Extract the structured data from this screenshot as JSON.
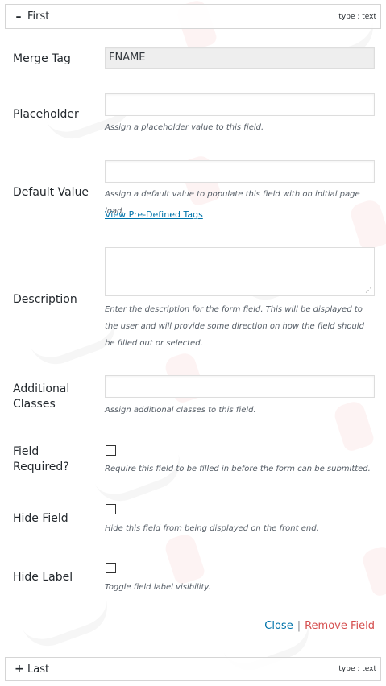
{
  "top_panel": {
    "toggle_symbol": "–",
    "title": "First",
    "type_label": "type : text"
  },
  "fields": {
    "merge_tag": {
      "label": "Merge Tag",
      "value": "FNAME"
    },
    "placeholder": {
      "label": "Placeholder",
      "value": "",
      "help": "Assign a placeholder value to this field."
    },
    "default_value": {
      "label": "Default Value",
      "value": "",
      "help": "Assign a default value to populate this field with on initial page load.",
      "link": "View Pre-Defined Tags"
    },
    "description": {
      "label": "Description",
      "value": "",
      "help": "Enter the description for the form field. This will be displayed to the user and will provide some direction on how the field should be filled out or selected."
    },
    "additional_classes": {
      "label": "Additional Classes",
      "value": "",
      "help": "Assign additional classes to this field."
    },
    "field_required": {
      "label": "Field Required?",
      "checked": false,
      "help": "Require this field to be filled in before the form can be submitted."
    },
    "hide_field": {
      "label": "Hide Field",
      "checked": false,
      "help": "Hide this field from being displayed on the front end."
    },
    "hide_label": {
      "label": "Hide Label",
      "checked": false,
      "help": "Toggle field label visibility."
    }
  },
  "actions": {
    "close": "Close",
    "separator": "|",
    "remove": "Remove Field"
  },
  "bottom_panel": {
    "toggle_symbol": "+",
    "title": "Last",
    "type_label": "type : text"
  },
  "colors": {
    "link": "#0073aa",
    "remove": "#d54e4e",
    "readonly_bg": "#eeeeee",
    "border": "#d5d5d5"
  }
}
